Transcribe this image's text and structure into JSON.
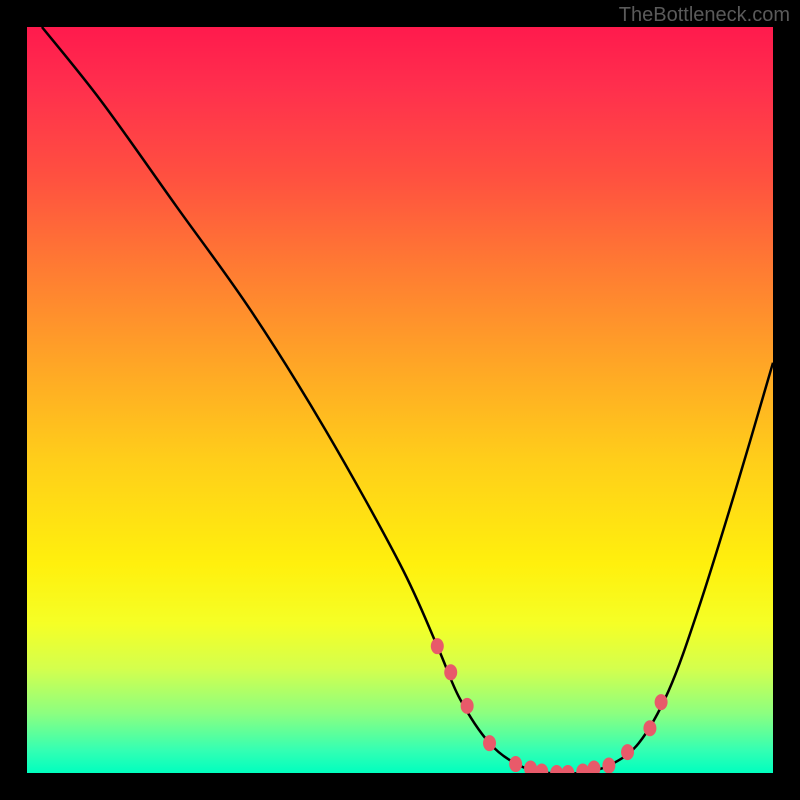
{
  "attribution": "TheBottleneck.com",
  "chart_data": {
    "type": "line",
    "title": "",
    "xlabel": "",
    "ylabel": "",
    "xlim": [
      0,
      100
    ],
    "ylim": [
      0,
      100
    ],
    "series": [
      {
        "name": "bottleneck-curve",
        "x": [
          2,
          10,
          20,
          30,
          40,
          50,
          55,
          58,
          62,
          66,
          70,
          74,
          78,
          82,
          86,
          90,
          95,
          100
        ],
        "y": [
          100,
          90,
          76,
          62,
          46,
          28,
          17,
          10,
          4,
          1,
          0,
          0,
          1,
          4,
          11,
          22,
          38,
          55
        ]
      }
    ],
    "markers": {
      "name": "highlight-dots",
      "x": [
        55.0,
        56.8,
        59.0,
        62.0,
        65.5,
        67.5,
        69.0,
        71.0,
        72.5,
        74.5,
        76.0,
        78.0,
        80.5,
        83.5,
        85.0
      ],
      "y": [
        17.0,
        13.5,
        9.0,
        4.0,
        1.2,
        0.6,
        0.2,
        0.0,
        0.0,
        0.2,
        0.6,
        1.0,
        2.8,
        6.0,
        9.5
      ]
    },
    "background": {
      "type": "vertical-gradient",
      "stops": [
        {
          "pos": 0,
          "color": "#ff1a4d"
        },
        {
          "pos": 45,
          "color": "#ffa526"
        },
        {
          "pos": 72,
          "color": "#fff00d"
        },
        {
          "pos": 100,
          "color": "#00ffbf"
        }
      ]
    }
  }
}
